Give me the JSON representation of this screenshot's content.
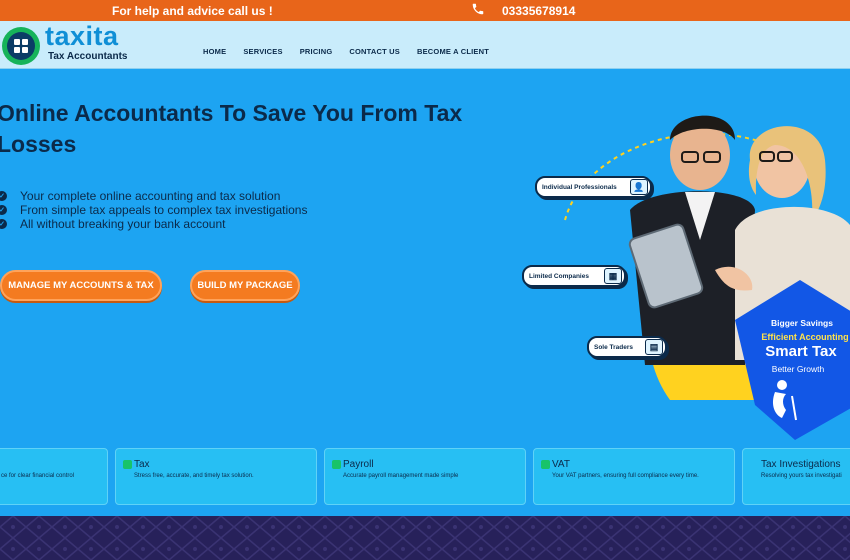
{
  "topbar": {
    "help_text": "For help and advice call us !",
    "phone": "03335678914",
    "icon": "phone-icon"
  },
  "brand": {
    "name": "taxita",
    "tagline": "Tax Accountants"
  },
  "nav": {
    "items": [
      "HOME",
      "SERVICES",
      "PRICING",
      "CONTACT US",
      "BECOME A CLIENT"
    ]
  },
  "hero": {
    "title": "Online Accountants To Save You From Tax Losses",
    "points": [
      "Your complete online accounting and tax solution",
      "From simple tax appeals to complex tax investigations",
      "All without breaking your bank account"
    ],
    "primary_button": "MANAGE MY ACCOUNTS & TAX",
    "secondary_button": "BUILD MY PACKAGE"
  },
  "art": {
    "labels": [
      "Individual Professionals",
      "Limited Companies",
      "Sole Traders"
    ],
    "promo": [
      "Bigger Savings",
      "Efficient Accounting",
      "Smart Tax",
      "Better Growth"
    ]
  },
  "services": [
    {
      "title": "",
      "desc": "ce for clear financial control"
    },
    {
      "title": "Tax",
      "desc": "Stress free, accurate, and timely tax solution."
    },
    {
      "title": "Payroll",
      "desc": "Accurate payroll management made simple"
    },
    {
      "title": "VAT",
      "desc": "Your VAT partners, ensuring full compliance every time."
    },
    {
      "title": "Tax Investigations",
      "desc": "Resolving yours tax investigati"
    }
  ],
  "colors": {
    "topbar": "#e8651a",
    "hero_bg": "#1da4f2",
    "navy": "#0b2a4a",
    "accent_orange": "#f47b20",
    "brand_green": "#16b35a",
    "promo_blue": "#1257e6",
    "promo_yellow": "#ffd21f"
  }
}
